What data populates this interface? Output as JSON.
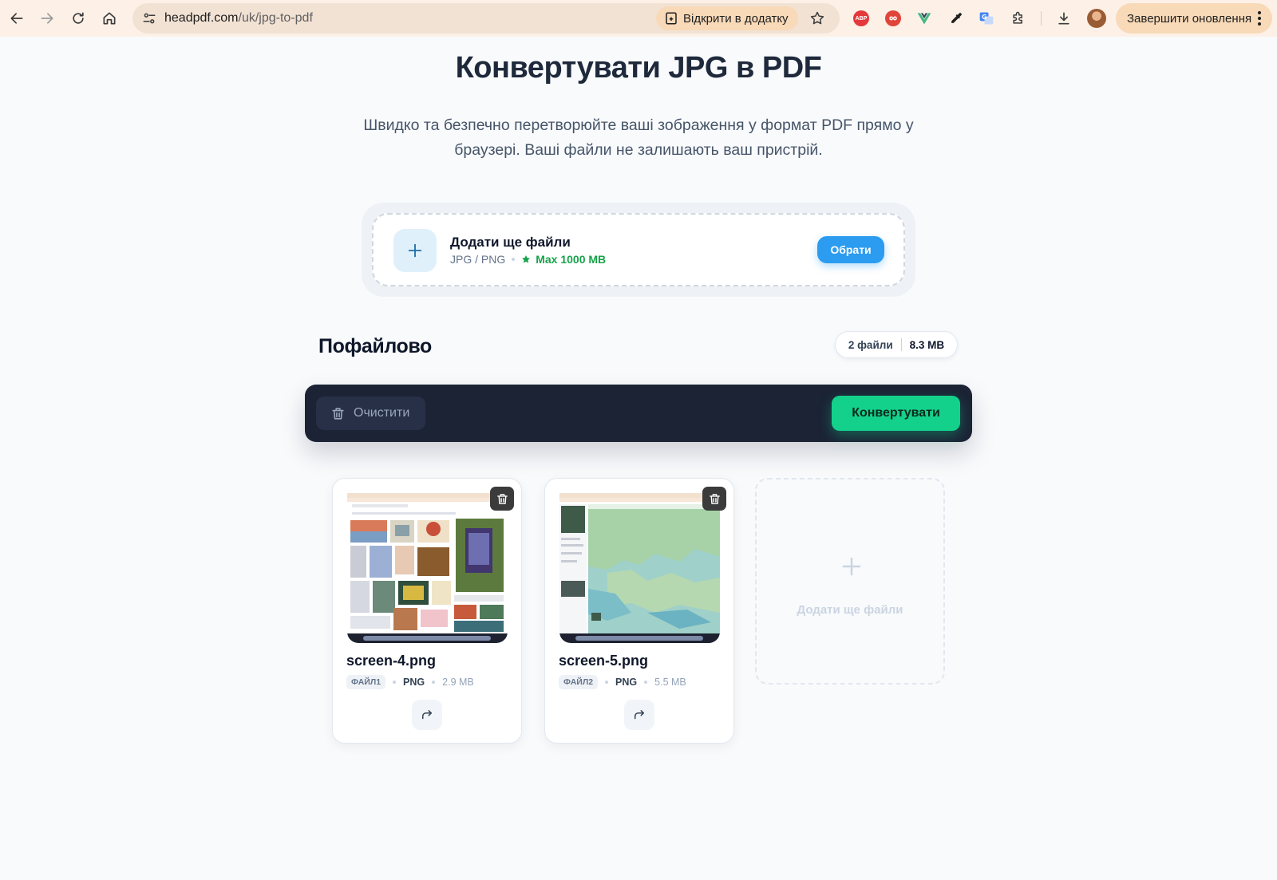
{
  "browser": {
    "url_host": "headpdf.com",
    "url_path": "/uk/jpg-to-pdf",
    "open_in_app_label": "Відкрити в додатку",
    "abp_label": "ABP",
    "update_label": "Завершити оновлення"
  },
  "page": {
    "title": "Конвертувати JPG в PDF",
    "subtitle": "Швидко та безпечно перетворюйте ваші зображення у формат PDF прямо у браузері. Ваші файли не залишають ваш пристрій."
  },
  "upload": {
    "title": "Додати ще файли",
    "formats": "JPG / PNG",
    "max_size": "Max 1000 MB",
    "choose_label": "Обрати"
  },
  "files_section": {
    "title": "Пофайлово",
    "count_label": "2 файли",
    "total_size": "8.3 MB"
  },
  "toolbar": {
    "clear_label": "Очистити",
    "convert_label": "Конвертувати"
  },
  "files": [
    {
      "name": "screen-4.png",
      "badge": "ФАЙЛ1",
      "format": "PNG",
      "size": "2.9 MB"
    },
    {
      "name": "screen-5.png",
      "badge": "ФАЙЛ2",
      "format": "PNG",
      "size": "5.5 MB"
    }
  ],
  "add_card": {
    "label": "Додати ще файли"
  },
  "colors": {
    "chrome_bg": "#fdf1e7",
    "accent_blue": "#2b9cf0",
    "accent_green": "#13d18b",
    "toolbar_bg": "#1b2335"
  },
  "icons": [
    "back-icon",
    "forward-icon",
    "reload-icon",
    "home-icon",
    "site-info-icon",
    "open-app-icon",
    "star-icon",
    "abp-icon",
    "extension-red-icon",
    "vue-icon",
    "eyedropper-icon",
    "translate-icon",
    "puzzle-icon",
    "download-icon",
    "avatar",
    "kebab-icon",
    "plus-icon",
    "trash-icon",
    "rotate-icon"
  ]
}
